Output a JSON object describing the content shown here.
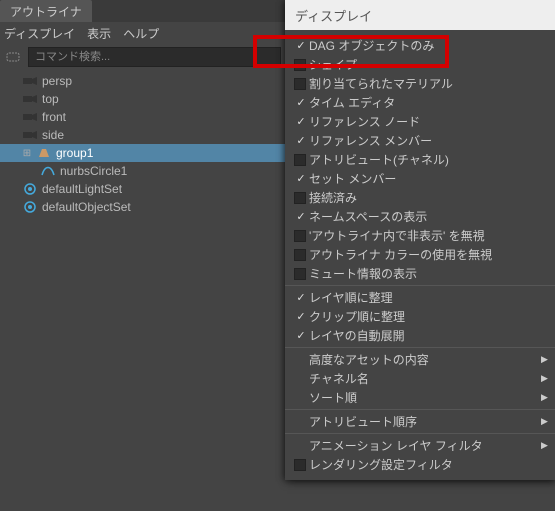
{
  "panel": {
    "tab_title": "アウトライナ",
    "menus": {
      "display": "ディスプレイ",
      "show": "表示",
      "help": "ヘルプ"
    },
    "search_placeholder": "コマンド検索..."
  },
  "tree": {
    "persp": "persp",
    "top": "top",
    "front": "front",
    "side": "side",
    "group1": "group1",
    "nurbsCircle1": "nurbsCircle1",
    "defaultLightSet": "defaultLightSet",
    "defaultObjectSet": "defaultObjectSet"
  },
  "dd": {
    "header": "ディスプレイ",
    "g1": {
      "i0": "DAG オブジェクトのみ",
      "i1": "シェイプ",
      "i2": "割り当てられたマテリアル",
      "i3": "タイム エディタ",
      "i4": "リファレンス ノード",
      "i5": "リファレンス メンバー",
      "i6": "アトリビュート(チャネル)",
      "i7": "セット メンバー",
      "i8": "接続済み",
      "i9": "ネームスペースの表示",
      "i10": "'アウトライナ内で非表示' を無視",
      "i11": "アウトライナ カラーの使用を無視",
      "i12": "ミュート情報の表示"
    },
    "g2": {
      "i0": "レイヤ順に整理",
      "i1": "クリップ順に整理",
      "i2": "レイヤの自動展開"
    },
    "g3": {
      "i0": "高度なアセットの内容",
      "i1": "チャネル名",
      "i2": "ソート順"
    },
    "g4": {
      "i0": "アトリビュート順序"
    },
    "g5": {
      "i0": "アニメーション レイヤ フィルタ",
      "i1": "レンダリング設定フィルタ"
    }
  }
}
